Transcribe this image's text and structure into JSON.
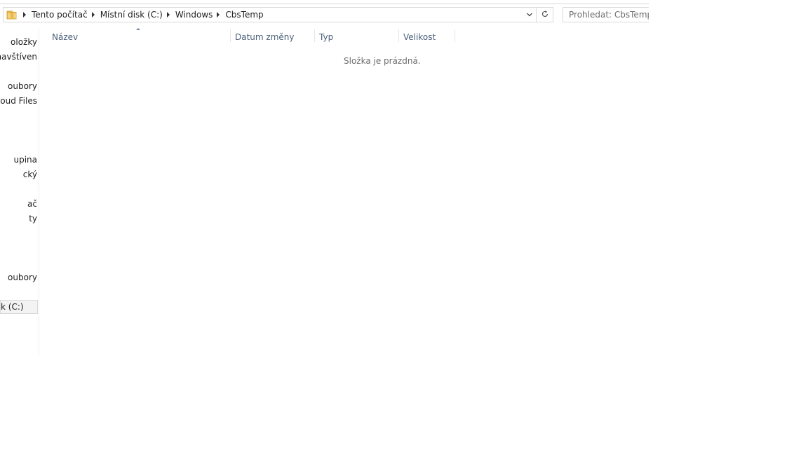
{
  "breadcrumb": {
    "items": [
      "Tento počítač",
      "Místní disk (C:)",
      "Windows",
      "CbsTemp"
    ]
  },
  "search": {
    "placeholder": "Prohledat: CbsTemp"
  },
  "nav_pane": {
    "items": [
      {
        "label": "oložky"
      },
      {
        "label": "y navštíven"
      },
      {
        "label": "oubory"
      },
      {
        "label": "Cloud Files"
      },
      {
        "label": "upina"
      },
      {
        "label": "cký"
      },
      {
        "label": "ač"
      },
      {
        "label": "ty"
      },
      {
        "label": "oubory"
      },
      {
        "label": "k (C:)",
        "selected": true
      }
    ]
  },
  "columns": {
    "name": "Název",
    "date_modified": "Datum změny",
    "type": "Typ",
    "size": "Velikost"
  },
  "content": {
    "empty_message": "Složka je prázdná."
  },
  "colors": {
    "header_text": "#4c607a",
    "border": "#d9d9d9",
    "folder_yellow": "#e8b94a"
  },
  "icons": {
    "folder": "folder-icon",
    "dropdown": "chevron-down-icon",
    "refresh": "refresh-icon",
    "sort": "sort-ascending-icon"
  }
}
